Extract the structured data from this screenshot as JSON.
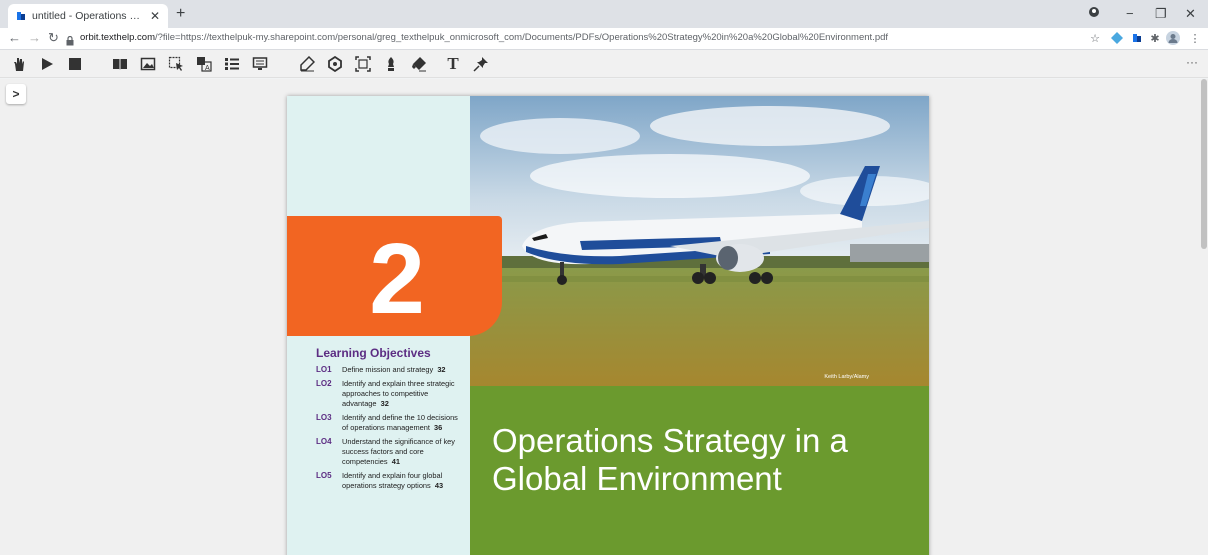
{
  "browser": {
    "tab_title": "untitled - Operations Strategy in",
    "new_tab": "+",
    "url_domain": "orbit.texthelp.com",
    "url_rest": "/?file=https://texthelpuk-my.sharepoint.com/personal/greg_texthelpuk_onmicrosoft_com/Documents/PDFs/Operations%20Strategy%20in%20a%20Global%20Environment.pdf",
    "controls": {
      "minimize": "−",
      "restore": "❐",
      "close": "✕"
    },
    "more": "⋮"
  },
  "toolbar": {
    "icons": [
      "hand-icon",
      "play-icon",
      "stop-icon",
      "book-icon",
      "image-icon",
      "select-icon",
      "text-select-icon",
      "list-icon",
      "screen-icon",
      "highlighter-icon",
      "settings-icon",
      "screenshot-icon",
      "pen-icon",
      "eraser-icon",
      "text-icon",
      "pin-icon"
    ],
    "more": "···"
  },
  "sidebar_toggle": ">",
  "document": {
    "chapter_number": "2",
    "photo_credit": "Keith Larby/Alamy",
    "book_title": "Operations Strategy in a Global Environment",
    "lo_heading": "Learning Objectives",
    "objectives": [
      {
        "code": "LO1",
        "text": "Define mission and strategy",
        "page": "32"
      },
      {
        "code": "LO2",
        "text": "Identify and explain three strategic approaches to competitive advantage",
        "page": "32"
      },
      {
        "code": "LO3",
        "text": "Identify and define the 10 decisions of operations management",
        "page": "36"
      },
      {
        "code": "LO4",
        "text": "Understand the significance of key success factors and core competencies",
        "page": "41"
      },
      {
        "code": "LO5",
        "text": "Identify and explain four global operations strategy options",
        "page": "43"
      }
    ]
  },
  "colors": {
    "chapter_orange": "#f26522",
    "title_green": "#6b9a2e",
    "panel_teal": "#dff2f1",
    "objective_purple": "#5c2d83"
  }
}
